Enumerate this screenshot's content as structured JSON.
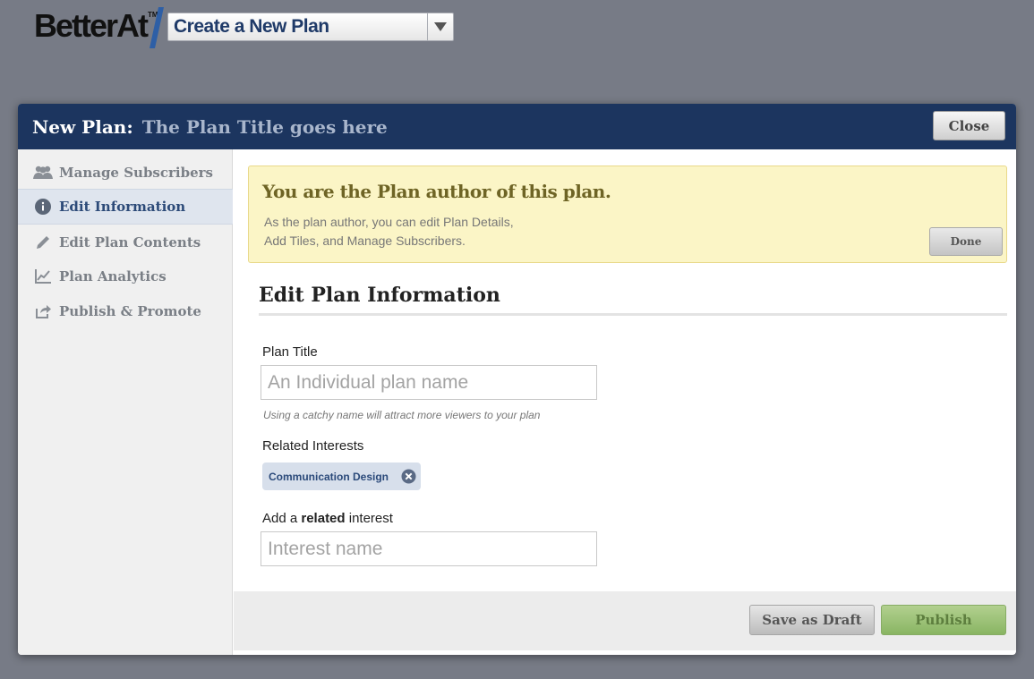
{
  "app": {
    "logo_text": "BetterAt",
    "logo_tm": "TM",
    "plan_select_value": "Create a New Plan"
  },
  "modal": {
    "label": "New Plan:",
    "title": "The Plan Title goes here",
    "close_label": "Close"
  },
  "sidebar": {
    "items": [
      {
        "label": "Manage Subscribers",
        "icon": "users-icon"
      },
      {
        "label": "Edit Information",
        "icon": "info-icon",
        "active": true
      },
      {
        "label": "Edit Plan Contents",
        "icon": "pencil-icon"
      },
      {
        "label": "Plan Analytics",
        "icon": "chart-icon"
      },
      {
        "label": "Publish & Promote",
        "icon": "share-icon"
      }
    ]
  },
  "notice": {
    "title": "You are the Plan author of this plan.",
    "line1": "As the plan author, you can edit Plan Details,",
    "line2": "Add Tiles, and Manage Subscribers.",
    "done_label": "Done"
  },
  "form": {
    "section_title": "Edit Plan Information",
    "plan_title_label": "Plan Title",
    "plan_title_placeholder": "An Individual plan name",
    "plan_title_value": "",
    "plan_title_hint": "Using a catchy name will attract more viewers to your plan",
    "related_label": "Related Interests",
    "related_tags": [
      "Communication Design"
    ],
    "add_related_prefix": "Add a ",
    "add_related_bold": "related",
    "add_related_suffix": " interest",
    "interest_placeholder": "Interest name"
  },
  "footer": {
    "save_draft_label": "Save as Draft",
    "publish_label": "Publish"
  },
  "colors": {
    "header_bg": "#1c355f",
    "notice_bg": "#fbf5c6",
    "publish_bg": "#9cc277",
    "page_bg": "#777b86"
  }
}
